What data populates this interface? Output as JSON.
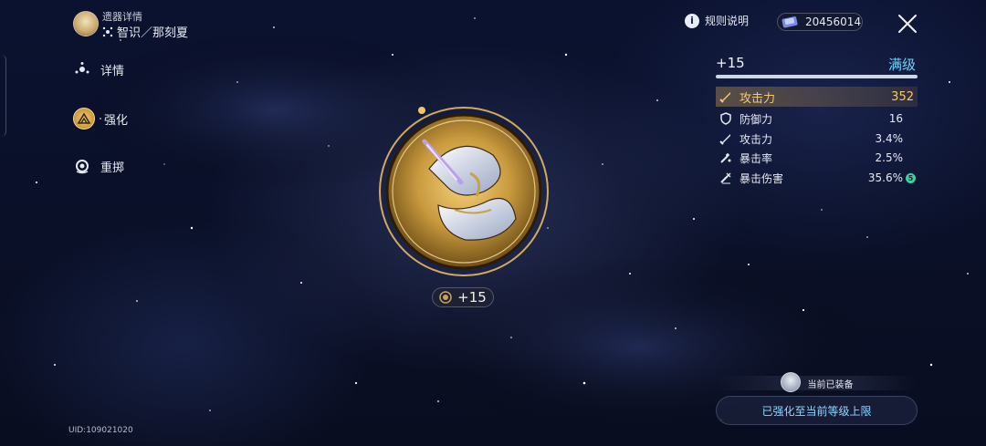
{
  "header": {
    "subtitle": "遗器详情",
    "title": "智识／那刻夏",
    "path_icon": "erudition-path-icon"
  },
  "nav": {
    "items": [
      {
        "label": "详情",
        "icon": "details-icon",
        "active": false
      },
      {
        "label": "强化",
        "icon": "enhance-icon",
        "active": true
      },
      {
        "label": "重掷",
        "icon": "reroll-icon",
        "active": false
      }
    ]
  },
  "uid": "UID:109021020",
  "topbar": {
    "rules_label": "规则说明",
    "currency_value": "20456014",
    "currency_icon": "relic-exp-ticket-icon"
  },
  "relic": {
    "level": "+15",
    "level_icon": "level-coin-icon"
  },
  "stats": {
    "level": "+15",
    "max_label": "满级",
    "progress": 1.0,
    "main": {
      "label": "攻击力",
      "value": "352",
      "icon": "sword-icon"
    },
    "subs": [
      {
        "label": "防御力",
        "value": "16",
        "icon": "shield-icon",
        "rolls": ""
      },
      {
        "label": "攻击力",
        "value": "3.4%",
        "icon": "sword-icon",
        "rolls": ""
      },
      {
        "label": "暴击率",
        "value": "2.5%",
        "icon": "crit-rate-icon",
        "rolls": ""
      },
      {
        "label": "暴击伤害",
        "value": "35.6%",
        "icon": "crit-dmg-icon",
        "rolls": "5"
      }
    ]
  },
  "equipped": {
    "label": "当前已装备"
  },
  "maxed_button": {
    "label": "已强化至当前等级上限"
  },
  "colors": {
    "accent_gold": "#f6c86a",
    "accent_blue": "#6ed2ff"
  }
}
